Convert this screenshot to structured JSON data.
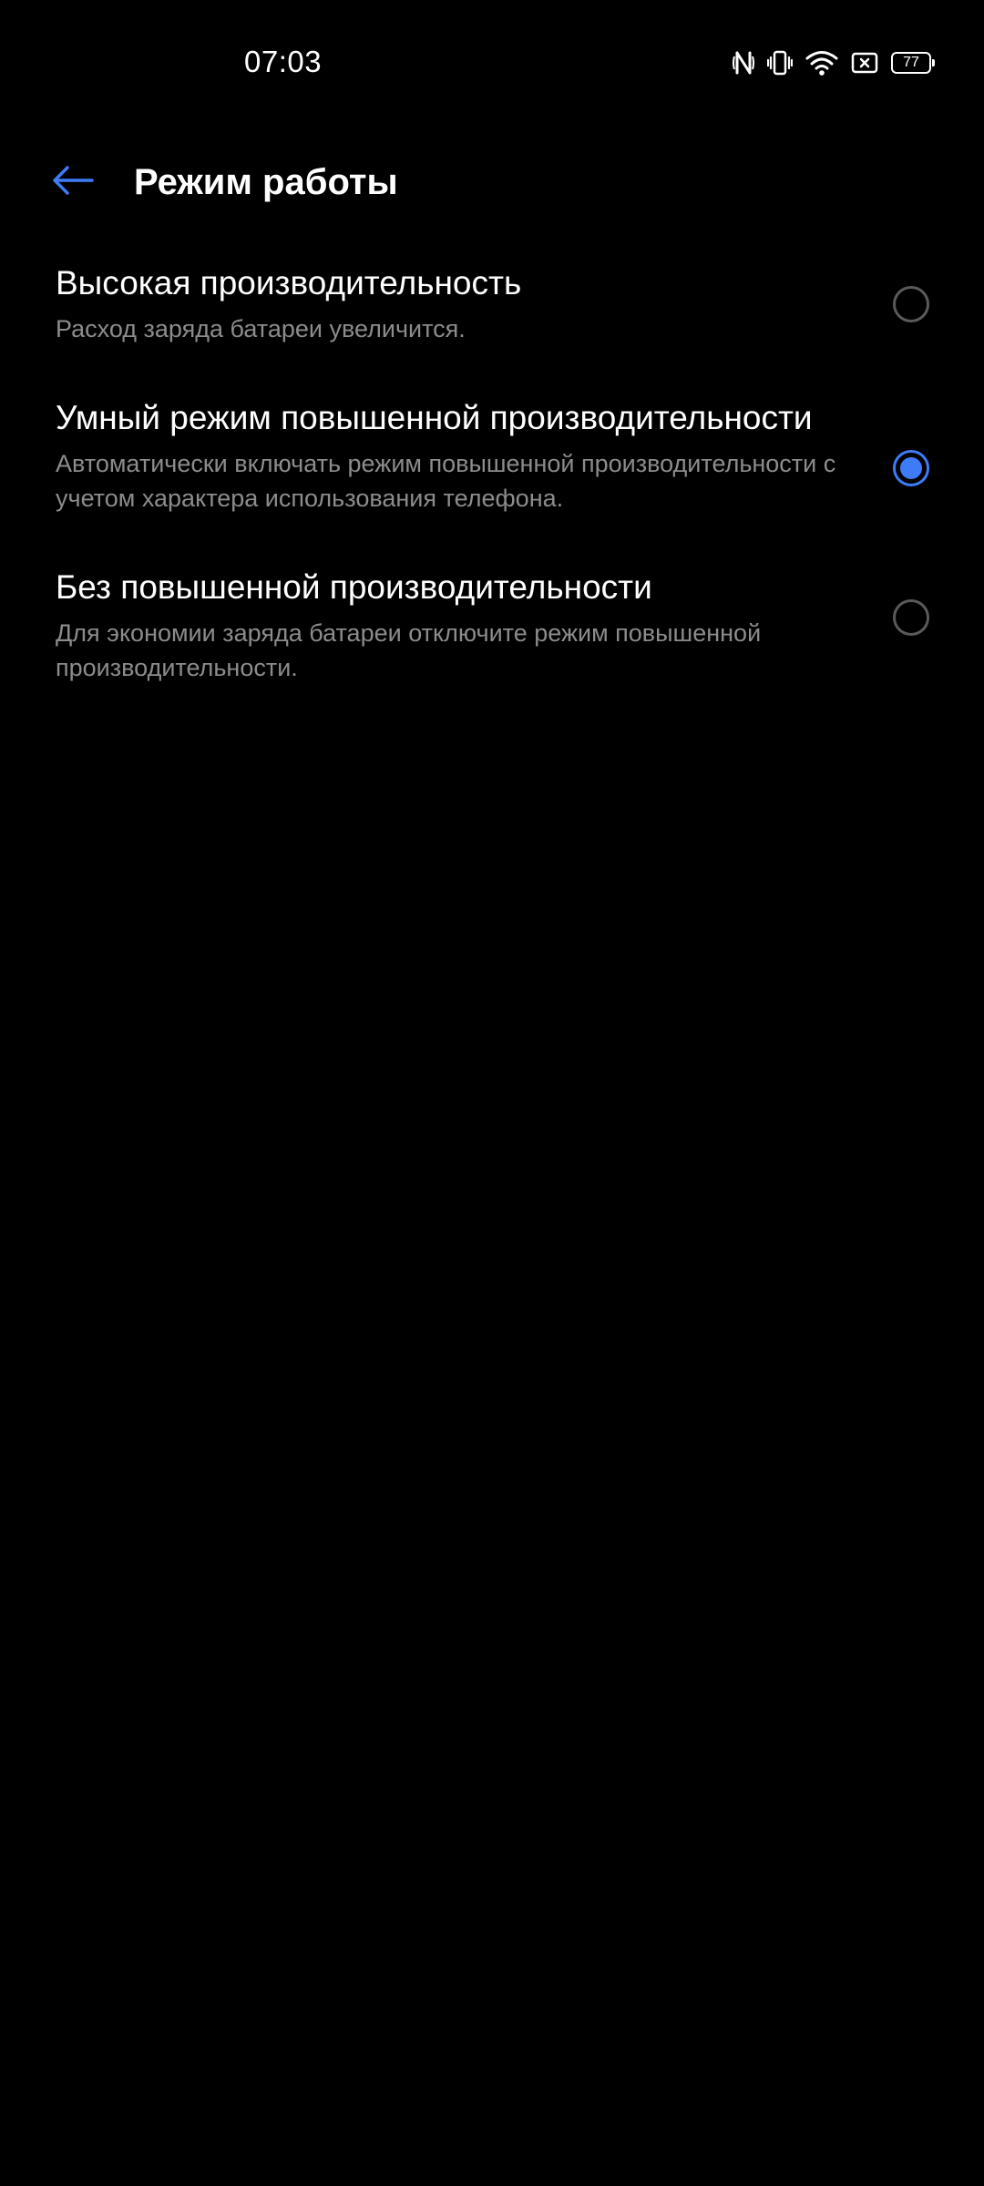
{
  "status_bar": {
    "time": "07:03",
    "battery_level": "77",
    "icons": [
      "nfc-icon",
      "vibrate-icon",
      "wifi-icon",
      "screen-record-icon",
      "battery-icon"
    ]
  },
  "header": {
    "back_icon": "arrow-left-icon",
    "title": "Режим работы"
  },
  "colors": {
    "accent": "#3d7bf7",
    "background": "#000000",
    "primary_text": "#ffffff",
    "secondary_text": "#8c8c8c",
    "radio_unchecked": "#5a5a5a"
  },
  "options": [
    {
      "title": "Высокая производительность",
      "description": "Расход заряда батареи увеличится.",
      "selected": false
    },
    {
      "title": "Умный режим повышенной производительности",
      "description": "Автоматически включать режим повышенной производительности с учетом характера использования телефона.",
      "selected": true
    },
    {
      "title": "Без повышенной производительности",
      "description": "Для экономии заряда батареи отключите режим повышенной производительности.",
      "selected": false
    }
  ]
}
